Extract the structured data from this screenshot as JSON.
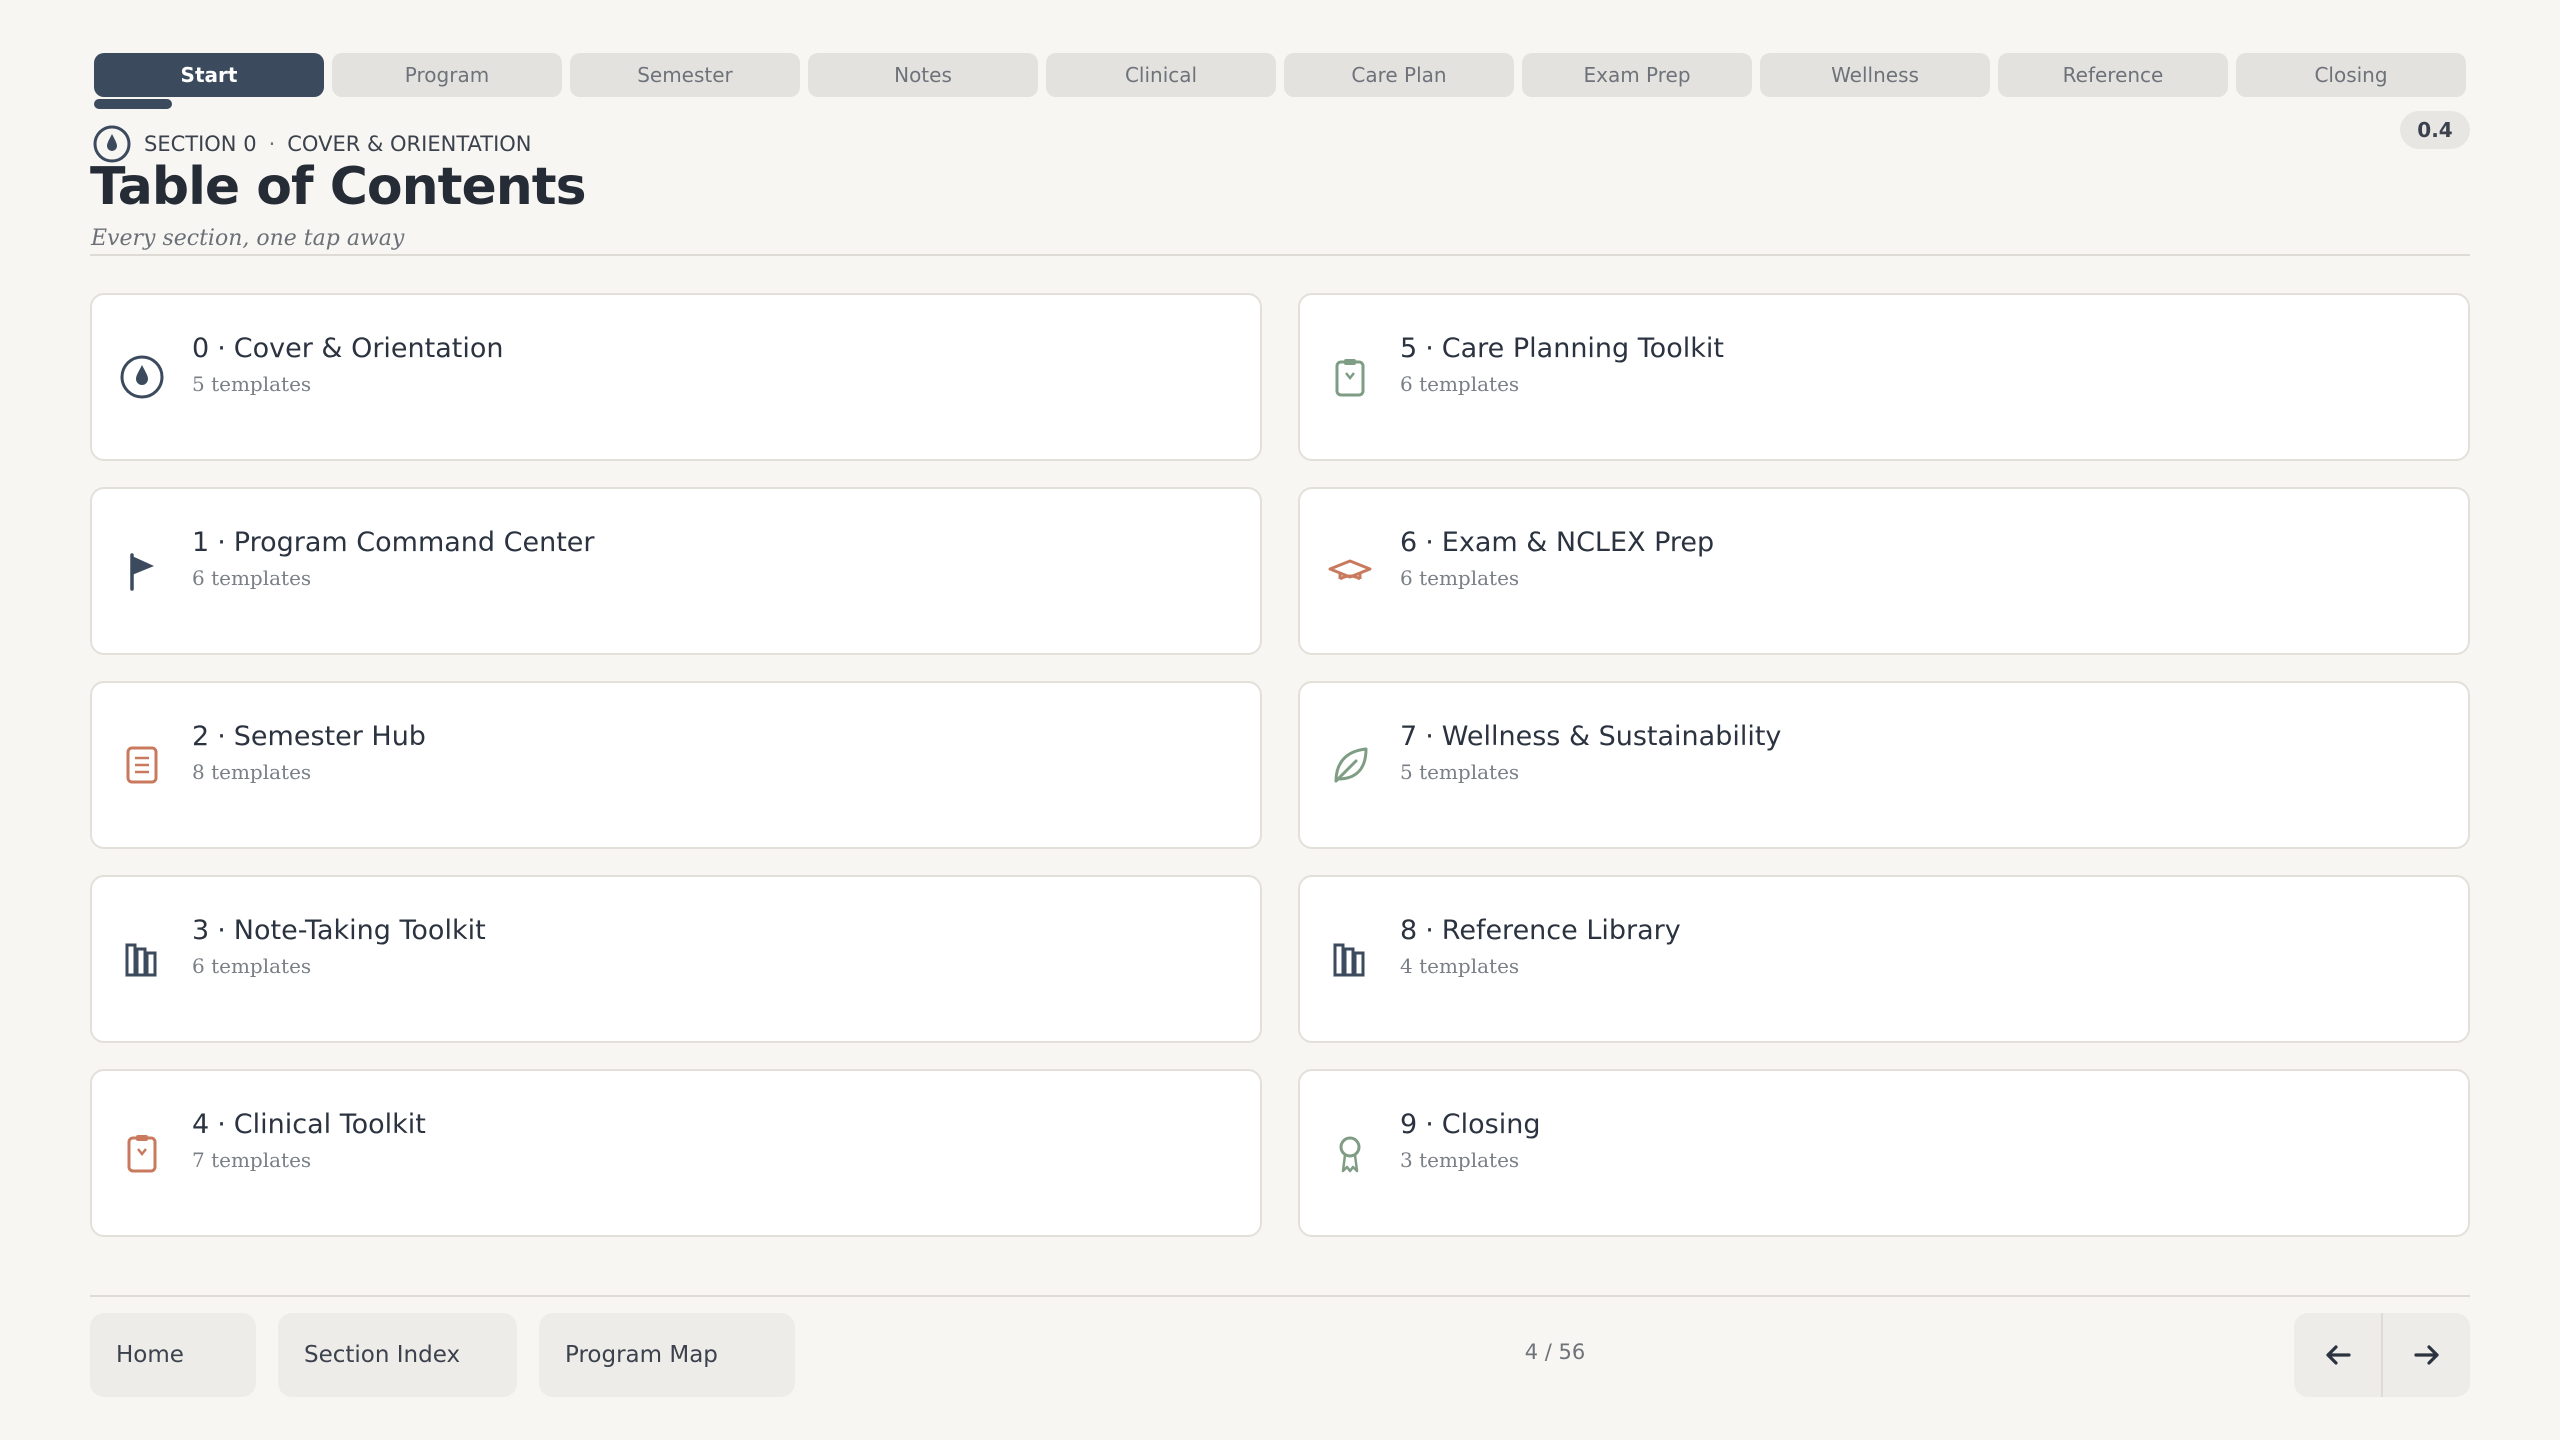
{
  "tabs": [
    {
      "label": "Start",
      "active": true
    },
    {
      "label": "Program"
    },
    {
      "label": "Semester"
    },
    {
      "label": "Notes"
    },
    {
      "label": "Clinical"
    },
    {
      "label": "Care Plan"
    },
    {
      "label": "Exam Prep"
    },
    {
      "label": "Wellness"
    },
    {
      "label": "Reference"
    },
    {
      "label": "Closing"
    }
  ],
  "header": {
    "section_label": "SECTION 0",
    "section_name": "COVER & ORIENTATION",
    "separator": "·",
    "title": "Table of Contents",
    "subtitle": "Every section, one tap away",
    "version": "0.4",
    "icon": "compass-drop-icon"
  },
  "sections": [
    {
      "num": "0",
      "name": "Cover & Orientation",
      "count": "5 templates",
      "icon": "compass-drop-icon",
      "color": "#3c4a5e"
    },
    {
      "num": "1",
      "name": "Program Command Center",
      "count": "6 templates",
      "icon": "flag-icon",
      "color": "#3c4a5e"
    },
    {
      "num": "2",
      "name": "Semester Hub",
      "count": "8 templates",
      "icon": "notepad-icon",
      "color": "#c97a5e"
    },
    {
      "num": "3",
      "name": "Note-Taking Toolkit",
      "count": "6 templates",
      "icon": "books-icon",
      "color": "#3c4a5e"
    },
    {
      "num": "4",
      "name": "Clinical Toolkit",
      "count": "7 templates",
      "icon": "clipboard-icon",
      "color": "#c97a5e"
    },
    {
      "num": "5",
      "name": "Care Planning Toolkit",
      "count": "6 templates",
      "icon": "clipboard-icon",
      "color": "#7f9c84"
    },
    {
      "num": "6",
      "name": "Exam & NCLEX Prep",
      "count": "6 templates",
      "icon": "graduation-cap-icon",
      "color": "#c97a5e"
    },
    {
      "num": "7",
      "name": "Wellness & Sustainability",
      "count": "5 templates",
      "icon": "leaf-icon",
      "color": "#7f9c84"
    },
    {
      "num": "8",
      "name": "Reference Library",
      "count": "4 templates",
      "icon": "books-icon",
      "color": "#3c4a5e"
    },
    {
      "num": "9",
      "name": "Closing",
      "count": "3 templates",
      "icon": "award-ribbon-icon",
      "color": "#7f9c84"
    }
  ],
  "footer": {
    "home": "Home",
    "section_index": "Section Index",
    "program_map": "Program Map",
    "page": "4 / 56",
    "prev_icon": "arrow-left-icon",
    "next_icon": "arrow-right-icon"
  },
  "colors": {
    "background": "#f8f6f2",
    "navy": "#3c4a5e",
    "terracotta": "#c97a5e",
    "sage": "#7f9c84"
  }
}
